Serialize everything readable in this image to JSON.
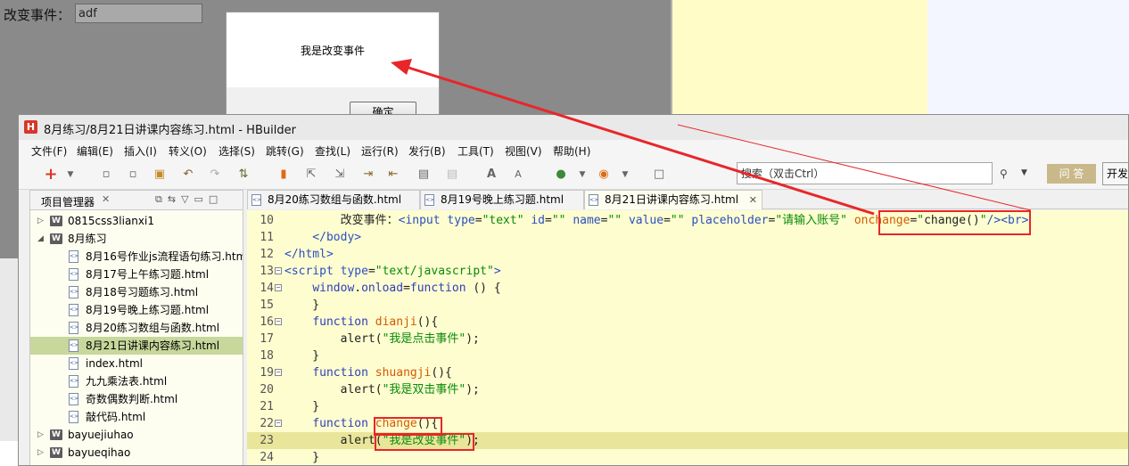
{
  "background_page": {
    "label": "改变事件：",
    "input_value": "adf",
    "alert": {
      "message": "我是改变事件",
      "ok_label": "确定"
    }
  },
  "window": {
    "title": "8月练习/8月21日讲课内容练习.html  -  HBuilder",
    "logo": "H"
  },
  "menu": [
    "文件(F)",
    "编辑(E)",
    "插入(I)",
    "转义(O)",
    "选择(S)",
    "跳转(G)",
    "查找(L)",
    "运行(R)",
    "发行(B)",
    "工具(T)",
    "视图(V)",
    "帮助(H)"
  ],
  "toolbar": {
    "search_placeholder": "搜索（双击Ctrl）",
    "ask_label": "问 答",
    "dev_label": "开发"
  },
  "explorer": {
    "title": "项目管理器",
    "items": [
      {
        "label": "0815css3lianxi1",
        "type": "project",
        "expanded": false
      },
      {
        "label": "8月练习",
        "type": "project",
        "expanded": true
      },
      {
        "label": "8月16号作业js流程语句练习.html",
        "type": "file"
      },
      {
        "label": "8月17号上午练习题.html",
        "type": "file"
      },
      {
        "label": "8月18号习题练习.html",
        "type": "file"
      },
      {
        "label": "8月19号晚上练习题.html",
        "type": "file"
      },
      {
        "label": "8月20练习数组与函数.html",
        "type": "file"
      },
      {
        "label": "8月21日讲课内容练习.html",
        "type": "file",
        "selected": true
      },
      {
        "label": "index.html",
        "type": "file"
      },
      {
        "label": "九九乘法表.html",
        "type": "file"
      },
      {
        "label": "奇数偶数判断.html",
        "type": "file"
      },
      {
        "label": "敲代码.html",
        "type": "file"
      },
      {
        "label": "bayuejiuhao",
        "type": "project",
        "expanded": false
      },
      {
        "label": "bayueqihao",
        "type": "project",
        "expanded": false
      }
    ]
  },
  "editor": {
    "tabs": [
      {
        "label": "8月20练习数组与函数.html",
        "active": false
      },
      {
        "label": "8月19号晚上练习题.html",
        "active": false
      },
      {
        "label": "8月21日讲课内容练习.html",
        "active": true
      }
    ],
    "lines": [
      {
        "n": "10",
        "parts": [
          [
            "plain",
            "        改变事件："
          ],
          [
            "tag",
            "<input "
          ],
          [
            "attr",
            "type"
          ],
          [
            "plain",
            "="
          ],
          [
            "str",
            "\"text\""
          ],
          [
            "plain",
            " "
          ],
          [
            "attr",
            "id"
          ],
          [
            "plain",
            "="
          ],
          [
            "str",
            "\"\""
          ],
          [
            "plain",
            " "
          ],
          [
            "attr",
            "name"
          ],
          [
            "plain",
            "="
          ],
          [
            "str",
            "\"\""
          ],
          [
            "plain",
            " "
          ],
          [
            "attr",
            "value"
          ],
          [
            "plain",
            "="
          ],
          [
            "str",
            "\"\""
          ],
          [
            "plain",
            " "
          ],
          [
            "attr",
            "placeholder"
          ],
          [
            "plain",
            "="
          ],
          [
            "str",
            "\"请输入账号\""
          ],
          [
            "plain",
            " "
          ],
          [
            "fn",
            "onchange"
          ],
          [
            "plain",
            "="
          ],
          [
            "str",
            "\""
          ],
          [
            "plain",
            "change()"
          ],
          [
            "str",
            "\""
          ],
          [
            "tag",
            "/><br>"
          ]
        ]
      },
      {
        "n": "11",
        "parts": [
          [
            "tag",
            "    </body>"
          ]
        ]
      },
      {
        "n": "12",
        "parts": [
          [
            "tag",
            "</html>"
          ]
        ]
      },
      {
        "n": "13",
        "fold": true,
        "parts": [
          [
            "tag",
            "<script "
          ],
          [
            "attr",
            "type"
          ],
          [
            "plain",
            "="
          ],
          [
            "str",
            "\"text/javascript\""
          ],
          [
            "tag",
            ">"
          ]
        ]
      },
      {
        "n": "14",
        "fold": true,
        "parts": [
          [
            "plain",
            "    "
          ],
          [
            "kw",
            "window"
          ],
          [
            "plain",
            "."
          ],
          [
            "kw",
            "onload"
          ],
          [
            "plain",
            "="
          ],
          [
            "kw",
            "function"
          ],
          [
            "plain",
            " () {"
          ]
        ]
      },
      {
        "n": "15",
        "parts": [
          [
            "plain",
            "    }"
          ]
        ]
      },
      {
        "n": "16",
        "fold": true,
        "parts": [
          [
            "plain",
            "    "
          ],
          [
            "kw",
            "function"
          ],
          [
            "plain",
            " "
          ],
          [
            "fn",
            "dianji"
          ],
          [
            "plain",
            "(){"
          ]
        ]
      },
      {
        "n": "17",
        "parts": [
          [
            "plain",
            "        alert("
          ],
          [
            "str",
            "\"我是点击事件\""
          ],
          [
            "plain",
            ");"
          ]
        ]
      },
      {
        "n": "18",
        "parts": [
          [
            "plain",
            "    }"
          ]
        ]
      },
      {
        "n": "19",
        "fold": true,
        "parts": [
          [
            "plain",
            "    "
          ],
          [
            "kw",
            "function"
          ],
          [
            "plain",
            " "
          ],
          [
            "fn",
            "shuangji"
          ],
          [
            "plain",
            "(){"
          ]
        ]
      },
      {
        "n": "20",
        "parts": [
          [
            "plain",
            "        alert("
          ],
          [
            "str",
            "\"我是双击事件\""
          ],
          [
            "plain",
            ");"
          ]
        ]
      },
      {
        "n": "21",
        "parts": [
          [
            "plain",
            "    }"
          ]
        ]
      },
      {
        "n": "22",
        "fold": true,
        "parts": [
          [
            "plain",
            "    "
          ],
          [
            "kw",
            "function"
          ],
          [
            "plain",
            " "
          ],
          [
            "fn",
            "change"
          ],
          [
            "plain",
            "(){"
          ]
        ]
      },
      {
        "n": "23",
        "current": true,
        "parts": [
          [
            "plain",
            "        alert("
          ],
          [
            "str",
            "\"我是改变事件\""
          ],
          [
            "plain",
            ");"
          ]
        ]
      },
      {
        "n": "24",
        "parts": [
          [
            "plain",
            "    }"
          ]
        ]
      }
    ]
  },
  "colors": {
    "annotation": "#e8262a",
    "selected_row": "#c8d79b",
    "editor_bg": "#fdfdd0",
    "current_line": "#e9e59a"
  }
}
